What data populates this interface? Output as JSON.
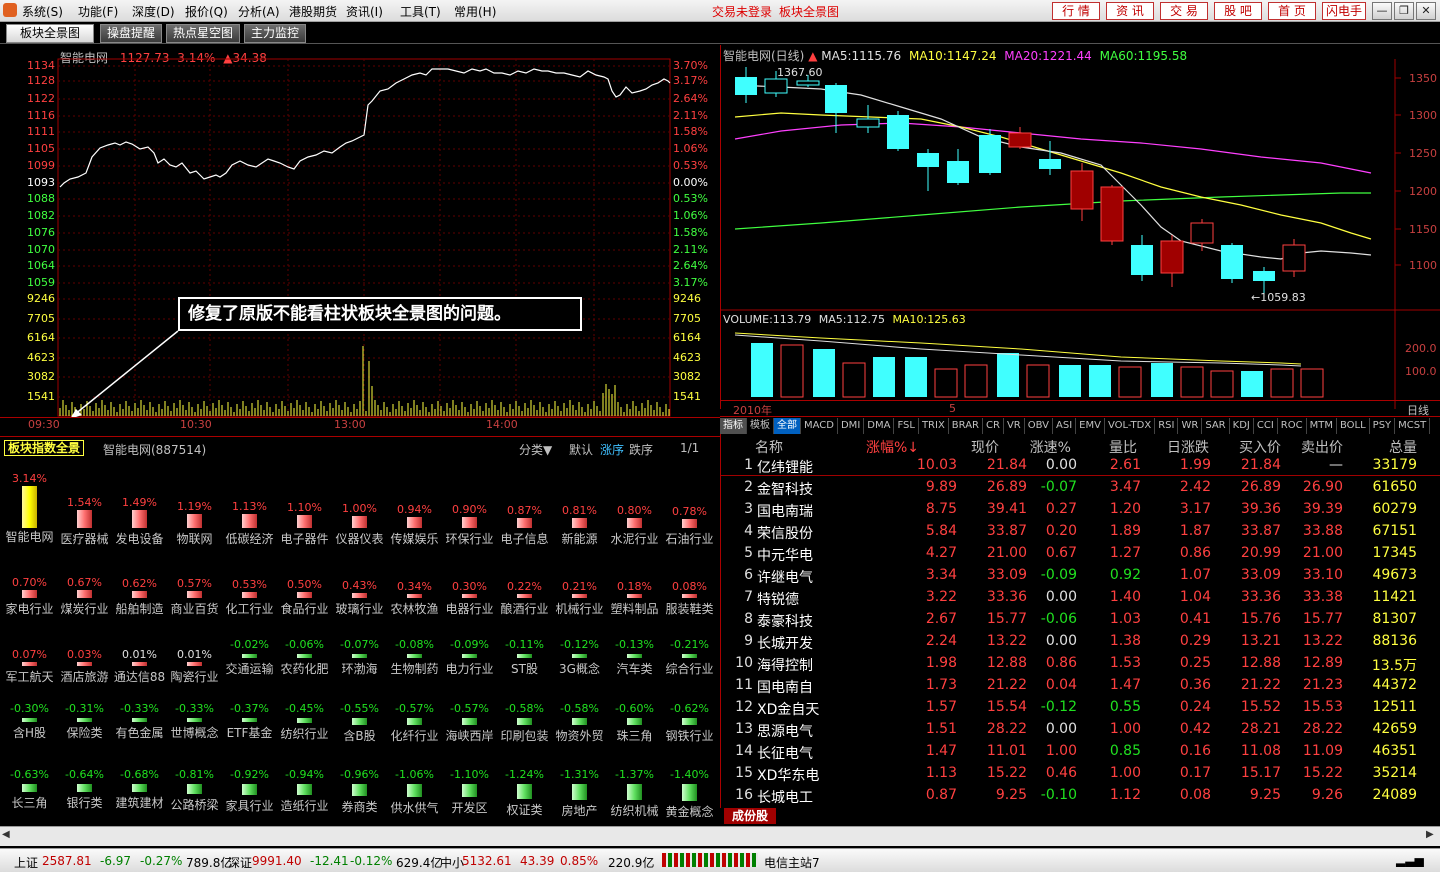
{
  "menu": {
    "items": [
      "系统(S)",
      "功能(F)",
      "深度(D)",
      "报价(Q)",
      "分析(A)",
      "港股期货",
      "资讯(I)",
      "工具(T)",
      "常用(H)"
    ],
    "center_left": "交易未登录",
    "center_right": "板块全景图",
    "right_buttons": [
      "行 情",
      "资 讯",
      "交 易",
      "股 吧",
      "首 页",
      "闪电手"
    ]
  },
  "tabs": [
    "板块全景图",
    "操盘提醒",
    "热点星空图",
    "主力监控"
  ],
  "intraday": {
    "title": "智能电网",
    "price": "1127.73",
    "pct": "3.14%",
    "change": "▲34.38",
    "left_axis": [
      "1134",
      "1128",
      "1122",
      "1116",
      "1111",
      "1105",
      "1099",
      "1093",
      "1088",
      "1082",
      "1076",
      "1070",
      "1064",
      "1059",
      "9246",
      "7705",
      "6164",
      "4623",
      "3082",
      "1541"
    ],
    "right_axis": [
      "3.70%",
      "3.17%",
      "2.64%",
      "2.11%",
      "1.58%",
      "1.06%",
      "0.53%",
      "0.00%",
      "0.53%",
      "1.06%",
      "1.58%",
      "2.11%",
      "2.64%",
      "3.17%",
      "9246",
      "7705",
      "6164",
      "4623",
      "3082",
      "1541"
    ],
    "time_labels": [
      "09:30",
      "10:30",
      "13:00",
      "14:00"
    ],
    "annotation": "修复了原版不能看柱状板块全景图的问题。"
  },
  "block_header": {
    "title": "板块指数全景",
    "subtitle": "智能电网(887514)",
    "category": "分类▼",
    "sorts": [
      "默认",
      "涨序",
      "跌序"
    ],
    "page": "1/1"
  },
  "blocks": [
    [
      "智能电网",
      "3.14%"
    ],
    [
      "医疗器械",
      "1.54%"
    ],
    [
      "发电设备",
      "1.49%"
    ],
    [
      "物联网",
      "1.19%"
    ],
    [
      "低碳经济",
      "1.13%"
    ],
    [
      "电子器件",
      "1.10%"
    ],
    [
      "仪器仪表",
      "1.00%"
    ],
    [
      "传媒娱乐",
      "0.94%"
    ],
    [
      "环保行业",
      "0.90%"
    ],
    [
      "电子信息",
      "0.87%"
    ],
    [
      "新能源",
      "0.81%"
    ],
    [
      "水泥行业",
      "0.80%"
    ],
    [
      "石油行业",
      "0.78%"
    ],
    [
      "家电行业",
      "0.70%"
    ],
    [
      "煤炭行业",
      "0.67%"
    ],
    [
      "船舶制造",
      "0.62%"
    ],
    [
      "商业百货",
      "0.57%"
    ],
    [
      "化工行业",
      "0.53%"
    ],
    [
      "食品行业",
      "0.50%"
    ],
    [
      "玻璃行业",
      "0.43%"
    ],
    [
      "农林牧渔",
      "0.34%"
    ],
    [
      "电器行业",
      "0.30%"
    ],
    [
      "酿酒行业",
      "0.22%"
    ],
    [
      "机械行业",
      "0.21%"
    ],
    [
      "塑料制品",
      "0.18%"
    ],
    [
      "服装鞋类",
      "0.08%"
    ],
    [
      "军工航天",
      "0.07%"
    ],
    [
      "酒店旅游",
      "0.03%"
    ],
    [
      "通达信88",
      "0.01%"
    ],
    [
      "陶瓷行业",
      "0.01%"
    ],
    [
      "交通运输",
      "-0.02%"
    ],
    [
      "农药化肥",
      "-0.06%"
    ],
    [
      "环渤海",
      "-0.07%"
    ],
    [
      "生物制药",
      "-0.08%"
    ],
    [
      "电力行业",
      "-0.09%"
    ],
    [
      "ST股",
      "-0.11%"
    ],
    [
      "3G概念",
      "-0.12%"
    ],
    [
      "汽车类",
      "-0.13%"
    ],
    [
      "综合行业",
      "-0.21%"
    ],
    [
      "含H股",
      "-0.30%"
    ],
    [
      "保险类",
      "-0.31%"
    ],
    [
      "有色金属",
      "-0.33%"
    ],
    [
      "世博概念",
      "-0.33%"
    ],
    [
      "ETF基金",
      "-0.37%"
    ],
    [
      "纺织行业",
      "-0.45%"
    ],
    [
      "含B股",
      "-0.55%"
    ],
    [
      "化纤行业",
      "-0.57%"
    ],
    [
      "海峡西岸",
      "-0.57%"
    ],
    [
      "印刷包装",
      "-0.58%"
    ],
    [
      "物资外贸",
      "-0.58%"
    ],
    [
      "珠三角",
      "-0.60%"
    ],
    [
      "钢铁行业",
      "-0.62%"
    ],
    [
      "长三角",
      "-0.63%"
    ],
    [
      "银行类",
      "-0.64%"
    ],
    [
      "建筑建材",
      "-0.68%"
    ],
    [
      "公路桥梁",
      "-0.81%"
    ],
    [
      "家具行业",
      "-0.92%"
    ],
    [
      "造纸行业",
      "-0.94%"
    ],
    [
      "券商类",
      "-0.96%"
    ],
    [
      "供水供气",
      "-1.06%"
    ],
    [
      "开发区",
      "-1.10%"
    ],
    [
      "权证类",
      "-1.24%"
    ],
    [
      "房地产",
      "-1.31%"
    ],
    [
      "纺织机械",
      "-1.37%"
    ],
    [
      "黄金概念",
      "-1.40%"
    ]
  ],
  "kline": {
    "title": "智能电网(日线)",
    "ma5": "MA5:1115.76",
    "ma10": "MA10:1147.24",
    "ma20": "MA20:1221.44",
    "ma60": "MA60:1195.58",
    "high_label": "1367.60",
    "low_label": "1059.83",
    "right_axis": [
      "1350",
      "1300",
      "1250",
      "1200",
      "1150",
      "1100"
    ],
    "volume": "VOLUME:113.79",
    "vol_ma5": "MA5:112.75",
    "vol_ma10": "MA10:125.63",
    "vol_axis": [
      "200.0",
      "100.0"
    ],
    "x_labels": [
      "2010年",
      "5"
    ],
    "period": "日线"
  },
  "indicators": [
    "指标",
    "模板",
    "全部",
    "MACD",
    "DMI",
    "DMA",
    "FSL",
    "TRIX",
    "BRAR",
    "CR",
    "VR",
    "OBV",
    "ASI",
    "EMV",
    "VOL-TDX",
    "RSI",
    "WR",
    "SAR",
    "KDJ",
    "CCI",
    "ROC",
    "MTM",
    "BOLL",
    "PSY",
    "MCST"
  ],
  "table": {
    "headers": [
      "名称",
      "涨幅%↓",
      "现价",
      "涨速%",
      "量比",
      "日涨跌",
      "买入价",
      "卖出价",
      "总量"
    ],
    "rows": [
      [
        "1",
        "亿纬锂能",
        "10.03",
        "21.84",
        "0.00",
        "2.61",
        "1.99",
        "21.84",
        "—",
        "33179"
      ],
      [
        "2",
        "金智科技",
        "9.89",
        "26.89",
        "-0.07",
        "3.47",
        "2.42",
        "26.89",
        "26.90",
        "61650"
      ],
      [
        "3",
        "国电南瑞",
        "8.75",
        "39.41",
        "0.27",
        "1.20",
        "3.17",
        "39.36",
        "39.39",
        "60279"
      ],
      [
        "4",
        "荣信股份",
        "5.84",
        "33.87",
        "0.20",
        "1.89",
        "1.87",
        "33.87",
        "33.88",
        "67151"
      ],
      [
        "5",
        "中元华电",
        "4.27",
        "21.00",
        "0.67",
        "1.27",
        "0.86",
        "20.99",
        "21.00",
        "17345"
      ],
      [
        "6",
        "许继电气",
        "3.34",
        "33.09",
        "-0.09",
        "0.92",
        "1.07",
        "33.09",
        "33.10",
        "49673"
      ],
      [
        "7",
        "特锐德",
        "3.22",
        "33.36",
        "0.00",
        "1.40",
        "1.04",
        "33.36",
        "33.38",
        "11421"
      ],
      [
        "8",
        "泰豪科技",
        "2.67",
        "15.77",
        "-0.06",
        "1.03",
        "0.41",
        "15.76",
        "15.77",
        "81307"
      ],
      [
        "9",
        "长城开发",
        "2.24",
        "13.22",
        "0.00",
        "1.38",
        "0.29",
        "13.21",
        "13.22",
        "88136"
      ],
      [
        "10",
        "海得控制",
        "1.98",
        "12.88",
        "0.86",
        "1.53",
        "0.25",
        "12.88",
        "12.89",
        "13.5万"
      ],
      [
        "11",
        "国电南自",
        "1.73",
        "21.22",
        "0.04",
        "1.47",
        "0.36",
        "21.22",
        "21.23",
        "44372"
      ],
      [
        "12",
        "XD金自天",
        "1.57",
        "15.54",
        "-0.12",
        "0.55",
        "0.24",
        "15.52",
        "15.53",
        "12511"
      ],
      [
        "13",
        "思源电气",
        "1.51",
        "28.22",
        "0.00",
        "1.00",
        "0.42",
        "28.21",
        "28.22",
        "42659"
      ],
      [
        "14",
        "长征电气",
        "1.47",
        "11.01",
        "1.00",
        "0.85",
        "0.16",
        "11.08",
        "11.09",
        "46351"
      ],
      [
        "15",
        "XD华东电",
        "1.13",
        "15.22",
        "0.46",
        "1.00",
        "0.17",
        "15.17",
        "15.22",
        "35214"
      ],
      [
        "16",
        "长城电工",
        "0.87",
        "9.25",
        "-0.10",
        "1.12",
        "0.08",
        "9.25",
        "9.26",
        "24089"
      ]
    ],
    "footer_tab": "成份股"
  },
  "status": {
    "sh_label": "上证",
    "sh": "2587.81",
    "sh_chg": "-6.97",
    "sh_pct": "-0.27%",
    "sh_amt": "789.8亿",
    "sz_label": "深证",
    "sz": "9991.40",
    "sz_chg": "-12.41",
    "sz_pct": "-0.12%",
    "sz_amt": "629.4亿",
    "zx_label": "中小",
    "zx": "5132.61",
    "zx_chg": "43.39",
    "zx_pct": "0.85%",
    "zx_amt": "220.9亿",
    "server": "电信主站7"
  }
}
